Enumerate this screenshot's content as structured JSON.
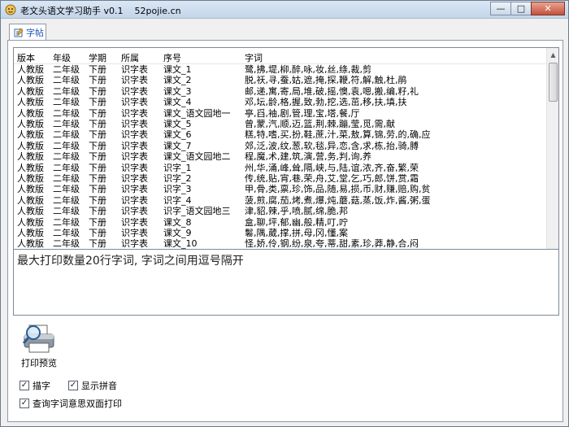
{
  "window": {
    "title": "老文头语文学习助手 v0.1    52pojie.cn"
  },
  "tabs": [
    {
      "label": "字帖"
    }
  ],
  "grid": {
    "columns": [
      "版本",
      "年级",
      "学期",
      "所属",
      "序号",
      "字词"
    ],
    "rows": [
      [
        "人教版",
        "二年级",
        "下册",
        "识字表",
        "课文_1",
        "鹭,拂,堤,柳,醉,咏,妆,丝,绦,裁,剪"
      ],
      [
        "人教版",
        "二年级",
        "下册",
        "识字表",
        "课文_2",
        "脱,祆,寻,蚕,姑,遮,掩,探,鞭,符,解,触,杜,鹃"
      ],
      [
        "人教版",
        "二年级",
        "下册",
        "识字表",
        "课文_3",
        "邮,递,寓,寄,局,堆,破,摇,懊,袁,嗯,搬,编,籽,礼"
      ],
      [
        "人教版",
        "二年级",
        "下册",
        "识字表",
        "课文_4",
        "邓,坛,龄,格,握,致,勃,挖,选,茁,移,扶,填,扶"
      ],
      [
        "人教版",
        "二年级",
        "下册",
        "识字表",
        "课文_语文园地一",
        "亭,舀,袖,剧,管,理,宝,塔,餐,厅"
      ],
      [
        "人教版",
        "二年级",
        "下册",
        "识字表",
        "课文_5",
        "曾,蒙,汽,顺,迈,篮,荆,棘,蹦,莹,觅,需,献"
      ],
      [
        "人教版",
        "二年级",
        "下册",
        "识字表",
        "课文_6",
        "糕,特,嗜,买,扮,鞋,蔗,汁,菜,敖,算,锦,劳,的,确,应"
      ],
      [
        "人教版",
        "二年级",
        "下册",
        "识字表",
        "课文_7",
        "郊,泛,波,纹,葱,软,毯,异,恋,含,求,栋,抬,骑,膊"
      ],
      [
        "人教版",
        "二年级",
        "下册",
        "识字表",
        "课文_语文园地二",
        "程,魔,术,建,筑,演,营,务,判,询,养"
      ],
      [
        "人教版",
        "二年级",
        "下册",
        "识字表",
        "识字_1",
        "州,华,涌,峰,耸,隔,峡,与,陆,谊,浓,齐,奋,繁,荣"
      ],
      [
        "人教版",
        "二年级",
        "下册",
        "识字表",
        "识字_2",
        "传,统,贴,宵,巷,荣,舟,艾,堂,乞,巧,郎,饼,赏,霜"
      ],
      [
        "人教版",
        "二年级",
        "下册",
        "识字表",
        "识字_3",
        "甲,骨,类,禀,珍,饰,品,随,易,损,币,财,赚,赔,购,贫"
      ],
      [
        "人教版",
        "二年级",
        "下册",
        "识字表",
        "识字_4",
        "菠,煎,腐,茄,烤,煮,爆,炖,蘑,菇,蒸,饭,炸,酱,粥,蛋"
      ],
      [
        "人教版",
        "二年级",
        "下册",
        "识字表",
        "识字_语文园地三",
        "津,貂,辣,乎,喷,腻,绵,脆,邦"
      ],
      [
        "人教版",
        "二年级",
        "下册",
        "识字表",
        "课文_8",
        "盒,聊,坪,郁,幽,般,精,叮,咛"
      ],
      [
        "人教版",
        "二年级",
        "下册",
        "识字表",
        "课文_9",
        "鬈,隅,葳,撑,拼,母,冈,懂,案"
      ],
      [
        "人教版",
        "二年级",
        "下册",
        "识字表",
        "课文_10",
        "怪,娇,伶,钢,纷,泉,夸,蒂,甜,素,珍,莽,静,合,闷"
      ]
    ]
  },
  "note": "最大打印数量20行字词, 字词之间用逗号隔开",
  "buttons": {
    "print_preview": "打印预览"
  },
  "options": [
    {
      "label": "描字",
      "checked": true
    },
    {
      "label": "显示拼音",
      "checked": true
    },
    {
      "label": "查询字词意思双面打印",
      "checked": true
    }
  ]
}
